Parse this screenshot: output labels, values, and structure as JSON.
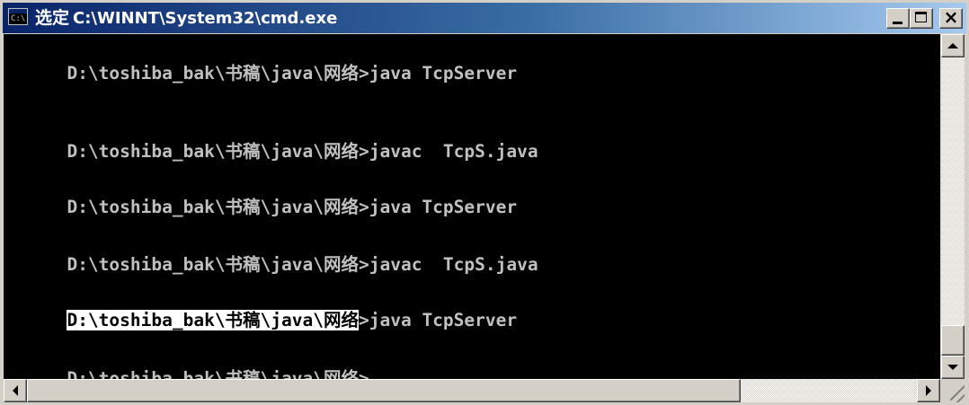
{
  "window": {
    "title_label": "选定",
    "title_path": "C:\\WINNT\\System32\\cmd.exe",
    "icon_text": "C:\\",
    "minimize_icon": "minimize-icon",
    "maximize_icon": "maximize-icon",
    "close_glyph": "×"
  },
  "console": {
    "lines": [
      {
        "prefix": "",
        "selected": "",
        "rest": "D:\\toshiba_bak\\书稿\\java\\网络>java TcpServer"
      },
      {
        "prefix": "",
        "selected": "",
        "rest": "D:\\toshiba_bak\\书稿\\java\\网络>javac  TcpS.java"
      },
      {
        "prefix": "",
        "selected": "",
        "rest": "D:\\toshiba_bak\\书稿\\java\\网络>java TcpServer"
      },
      {
        "prefix": "",
        "selected": "",
        "rest": "D:\\toshiba_bak\\书稿\\java\\网络>javac  TcpS.java"
      },
      {
        "prefix": "",
        "selected": "D:\\toshiba_bak\\书稿\\java\\网络",
        "rest": ">java TcpServer"
      },
      {
        "prefix": "",
        "selected": "",
        "rest": "D:\\toshiba_bak\\书稿\\java\\网络>"
      }
    ],
    "text_color": "#c0c0c0",
    "background": "#000000",
    "selection_background": "#ffffff",
    "selection_color": "#000000"
  },
  "scrollbars": {
    "vertical": {
      "up_icon": "up-arrow-icon",
      "down_icon": "down-arrow-icon",
      "position_fraction": 0.92
    },
    "horizontal": {
      "left_icon": "left-arrow-icon",
      "right_icon": "right-arrow-icon",
      "position_fraction": 0.0
    }
  },
  "colors": {
    "titlebar_start": "#0a246a",
    "titlebar_end": "#a6caf0",
    "chrome": "#d4d0c8"
  }
}
